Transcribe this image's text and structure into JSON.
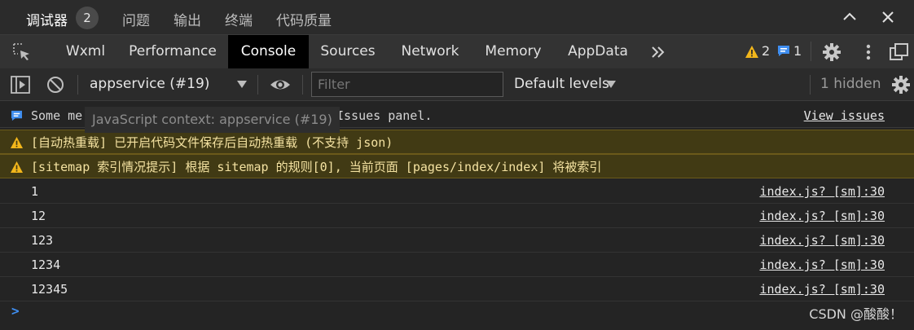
{
  "panel_tabs": [
    {
      "label": "调试器",
      "active": true
    },
    {
      "label": "问题"
    },
    {
      "label": "输出"
    },
    {
      "label": "终端"
    },
    {
      "label": "代码质量"
    }
  ],
  "panel_badge": "2",
  "devtools_tabs": [
    "Wxml",
    "Performance",
    "Console",
    "Sources",
    "Network",
    "Memory",
    "AppData"
  ],
  "active_tab": "Console",
  "warnings_count": "2",
  "messages_count": "1",
  "toolbar": {
    "context": "appservice (#19)",
    "filter_placeholder": "Filter",
    "levels": "Default levels",
    "hidden": "1 hidden"
  },
  "tooltip": "JavaScript context: appservice (#19)",
  "console": {
    "info_prefix": "Some me",
    "info_suffix": "Issues panel.",
    "view_issues": "View issues",
    "warnings": [
      "[自动热重载] 已开启代码文件保存后自动热重载 (不支持 json)",
      "[sitemap 索引情况提示] 根据 sitemap 的规则[0], 当前页面 [pages/index/index] 将被索引"
    ],
    "logs": [
      {
        "text": "1",
        "source": "index.js? [sm]:30"
      },
      {
        "text": "12",
        "source": "index.js? [sm]:30"
      },
      {
        "text": "123",
        "source": "index.js? [sm]:30"
      },
      {
        "text": "1234",
        "source": "index.js? [sm]:30"
      },
      {
        "text": "12345",
        "source": "index.js? [sm]:30"
      }
    ],
    "prompt": ">"
  },
  "watermark": "CSDN @酸酸！",
  "colors": {
    "warning": "#f2b61b",
    "info": "#3f8ef0",
    "bg": "#242424"
  }
}
